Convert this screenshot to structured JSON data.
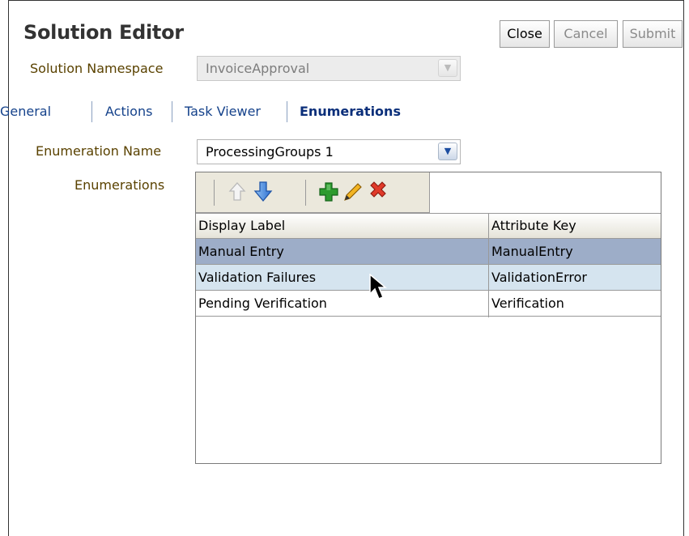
{
  "editor": {
    "title": "Solution Editor",
    "namespace_label": "Solution Namespace",
    "namespace_value": "InvoiceApproval",
    "buttons": {
      "close": "Close",
      "cancel": "Cancel",
      "submit": "Submit"
    }
  },
  "tabs": [
    {
      "label": "General",
      "active": false
    },
    {
      "label": "Actions",
      "active": false
    },
    {
      "label": "Task Viewer",
      "active": false
    },
    {
      "label": "Enumerations",
      "active": true
    }
  ],
  "enumeration": {
    "name_label": "Enumeration Name",
    "name_value": "ProcessingGroups 1",
    "list_label": "Enumerations"
  },
  "toolbar": {
    "icons": [
      "move-up-icon",
      "move-down-icon",
      "add-icon",
      "edit-icon",
      "delete-icon"
    ]
  },
  "table": {
    "columns": [
      "Display Label",
      "Attribute Key"
    ],
    "rows": [
      {
        "display": "Manual Entry",
        "key": "ManualEntry",
        "state": "selected"
      },
      {
        "display": "Validation Failures",
        "key": "ValidationError",
        "state": "hover"
      },
      {
        "display": "Pending Verification",
        "key": "Verification",
        "state": "normal"
      }
    ]
  },
  "colors": {
    "selected_row": "#9dadc8",
    "hover_row": "#d5e4ef",
    "label_text": "#5a4200",
    "tab_link": "#15428b"
  }
}
